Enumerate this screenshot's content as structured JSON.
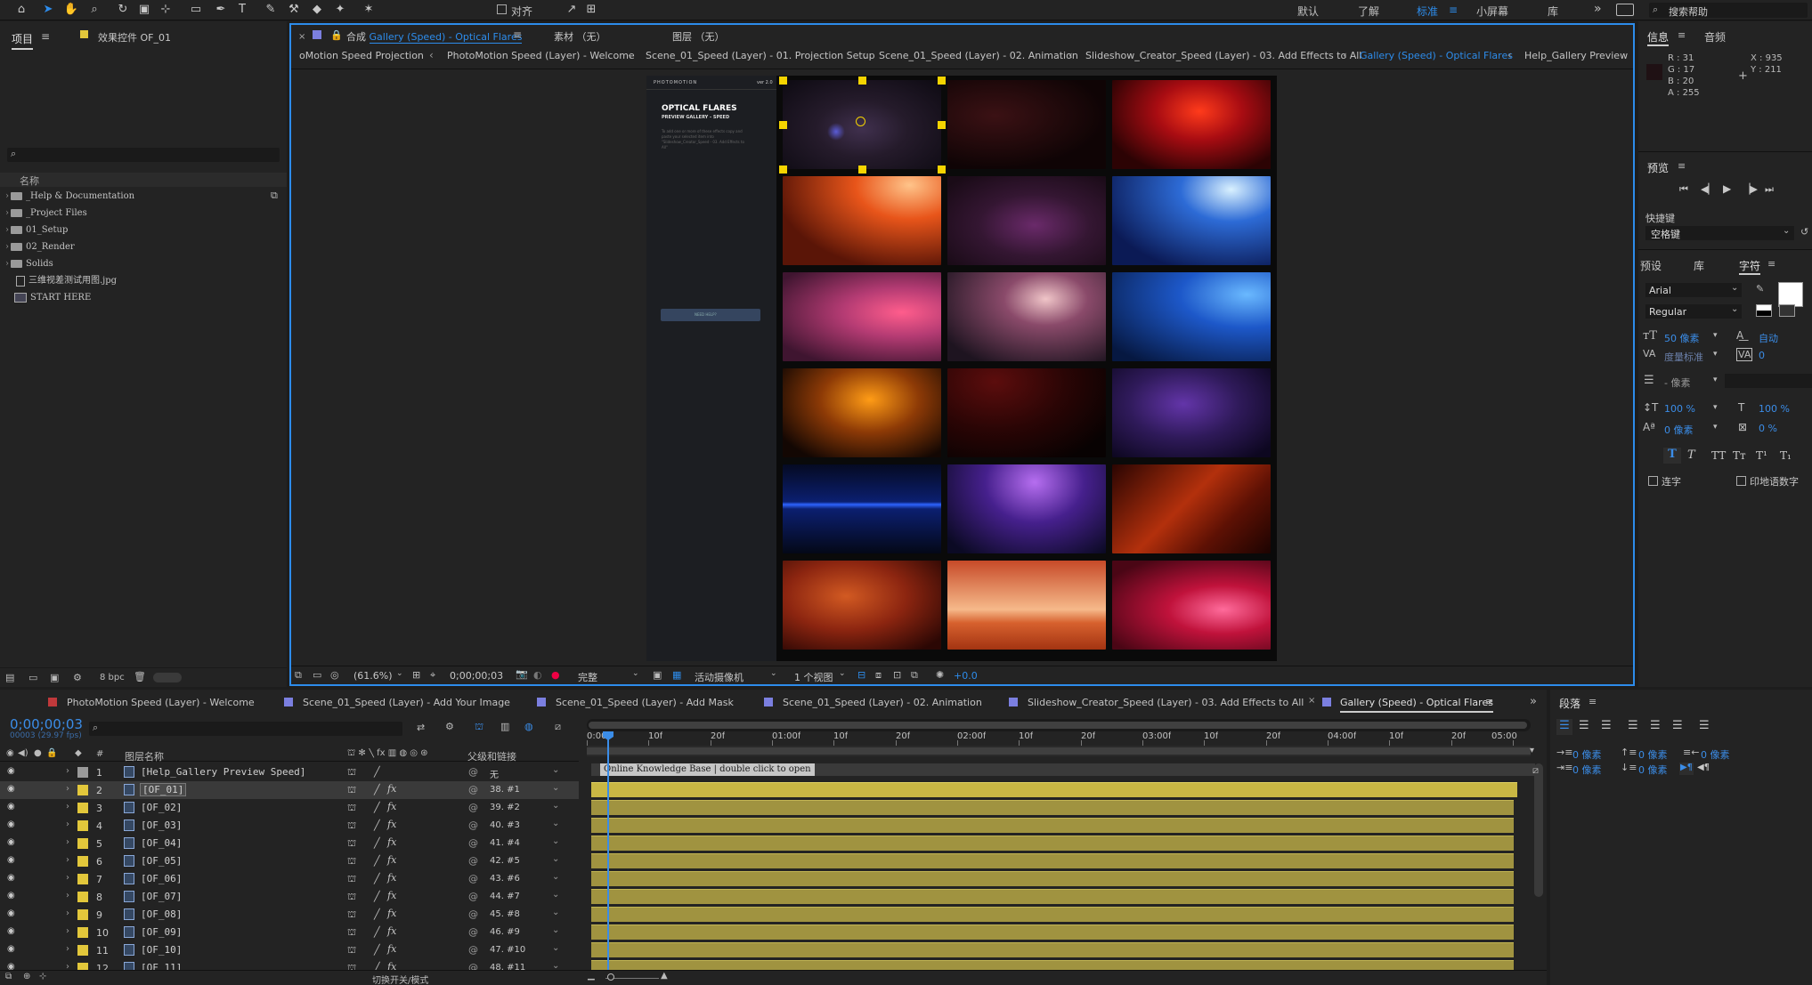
{
  "toolbar": {
    "snapping_label": "对齐",
    "workspaces": [
      "默认",
      "了解",
      "标准",
      "小屏幕",
      "库"
    ],
    "active_workspace": "标准",
    "search_placeholder": "搜索帮助"
  },
  "project_panel": {
    "tab_label": "项目",
    "effects_tab_label": "效果控件 OF_01",
    "column_name": "名称",
    "items": [
      {
        "name": "_Help & Documentation",
        "type": "folder"
      },
      {
        "name": "_Project Files",
        "type": "folder"
      },
      {
        "name": "01_Setup",
        "type": "folder"
      },
      {
        "name": "02_Render",
        "type": "folder"
      },
      {
        "name": "Solids",
        "type": "folder"
      },
      {
        "name": "三维视差测试用图.jpg",
        "type": "image"
      },
      {
        "name": "START HERE",
        "type": "comp"
      }
    ],
    "bpc_label": "8 bpc"
  },
  "composition_panel": {
    "tab_prefix": "合成",
    "tab_name": "Gallery (Speed) - Optical Flares",
    "footage_tab": "素材 （无）",
    "layer_tab": "图层 （无）",
    "breadcrumbs": [
      "oMotion Speed Projection",
      "PhotoMotion Speed (Layer) - Welcome",
      "Scene_01_Speed (Layer) - 01. Projection Setup",
      "Scene_01_Speed (Layer) - 02. Animation",
      "Slideshow_Creator_Speed (Layer) - 03. Add Effects to All",
      "Gallery (Speed) - Optical Flares",
      "Help_Gallery Preview ..."
    ],
    "active_breadcrumb": "Gallery (Speed) - Optical Flares",
    "preview": {
      "brand": "PHOTOMOTION",
      "version": "ver 2.0",
      "title": "OPTICAL FLARES",
      "subtitle": "PREVIEW GALLERY - SPEED",
      "description": "To add one or more of these effects copy and paste your selected item into \"Slideshow_Creator_Speed - 03. Add Effects to All\"",
      "help_button": "NEED HELP?"
    },
    "footer": {
      "zoom": "(61.6%)",
      "timecode": "0;00;00;03",
      "resolution": "完整",
      "camera": "活动摄像机",
      "views": "1 个视图",
      "exposure": "+0.0"
    }
  },
  "timeline_panel": {
    "tabs": [
      {
        "label": "PhotoMotion Speed (Layer) - Welcome",
        "color": "#c0393b"
      },
      {
        "label": "Scene_01_Speed (Layer) - Add Your Image",
        "color": "#7b7fe0"
      },
      {
        "label": "Scene_01_Speed (Layer) - Add Mask",
        "color": "#7b7fe0"
      },
      {
        "label": "Scene_01_Speed (Layer) - 02. Animation",
        "color": "#7b7fe0"
      },
      {
        "label": "Slideshow_Creator_Speed (Layer) - 03. Add Effects to All",
        "color": "#7b7fe0"
      },
      {
        "label": "Gallery (Speed) - Optical Flares",
        "color": "#7b7fe0"
      }
    ],
    "timecode": "0;00;00;03",
    "fps": "00003 (29.97 fps)",
    "columns": {
      "num": "#",
      "layer_name": "图层名称",
      "parent": "父级和链接"
    },
    "ruler": [
      "0:00f",
      "10f",
      "20f",
      "01:00f",
      "10f",
      "20f",
      "02:00f",
      "10f",
      "20f",
      "03:00f",
      "10f",
      "20f",
      "04:00f",
      "10f",
      "20f",
      "05:00"
    ],
    "layers": [
      {
        "num": "1",
        "name": "[Help_Gallery Preview Speed]",
        "parent": "无",
        "fx": false,
        "label": "#9a9a9a"
      },
      {
        "num": "2",
        "name": "[OF_01]",
        "parent": "38. #1",
        "fx": true,
        "label": "#e2c73b"
      },
      {
        "num": "3",
        "name": "[OF_02]",
        "parent": "39. #2",
        "fx": true,
        "label": "#e2c73b"
      },
      {
        "num": "4",
        "name": "[OF_03]",
        "parent": "40. #3",
        "fx": true,
        "label": "#e2c73b"
      },
      {
        "num": "5",
        "name": "[OF_04]",
        "parent": "41. #4",
        "fx": true,
        "label": "#e2c73b"
      },
      {
        "num": "6",
        "name": "[OF_05]",
        "parent": "42. #5",
        "fx": true,
        "label": "#e2c73b"
      },
      {
        "num": "7",
        "name": "[OF_06]",
        "parent": "43. #6",
        "fx": true,
        "label": "#e2c73b"
      },
      {
        "num": "8",
        "name": "[OF_07]",
        "parent": "44. #7",
        "fx": true,
        "label": "#e2c73b"
      },
      {
        "num": "9",
        "name": "[OF_08]",
        "parent": "45. #8",
        "fx": true,
        "label": "#e2c73b"
      },
      {
        "num": "10",
        "name": "[OF_09]",
        "parent": "46. #9",
        "fx": true,
        "label": "#e2c73b"
      },
      {
        "num": "11",
        "name": "[OF_10]",
        "parent": "47. #10",
        "fx": true,
        "label": "#e2c73b"
      },
      {
        "num": "12",
        "name": "[OF_11]",
        "parent": "48. #11",
        "fx": true,
        "label": "#e2c73b"
      }
    ],
    "first_bar_label": "Online Knowledge Base | double click to open",
    "footer_label": "切换开关/模式"
  },
  "info_panel": {
    "tab": "信息",
    "audio_tab": "音频",
    "r": "R : 31",
    "g": "G : 17",
    "b": "B : 20",
    "a": "A : 255",
    "x": "X : 935",
    "y": "Y : 211"
  },
  "preview_panel": {
    "tab": "预览",
    "shortcut_label": "快捷键",
    "shortcut_value": "空格键"
  },
  "character_panel": {
    "tabs": [
      "预设",
      "库",
      "字符"
    ],
    "font": "Arial",
    "style": "Regular",
    "size": "50 像素",
    "leading": "自动",
    "kerning": "度量标准",
    "tracking": "0",
    "stroke": "- 像素",
    "vscale": "100 %",
    "hscale": "100 %",
    "baseline": "0 像素",
    "tsume": "0 %",
    "ligatures": "连字",
    "hindi_digits": "印地语数字"
  },
  "paragraph_panel": {
    "tab": "段落",
    "indent_left": "0 像素",
    "indent_right": "0 像素",
    "indent_first": "0 像素",
    "space_before": "0 像素",
    "space_after": "0 像素"
  }
}
